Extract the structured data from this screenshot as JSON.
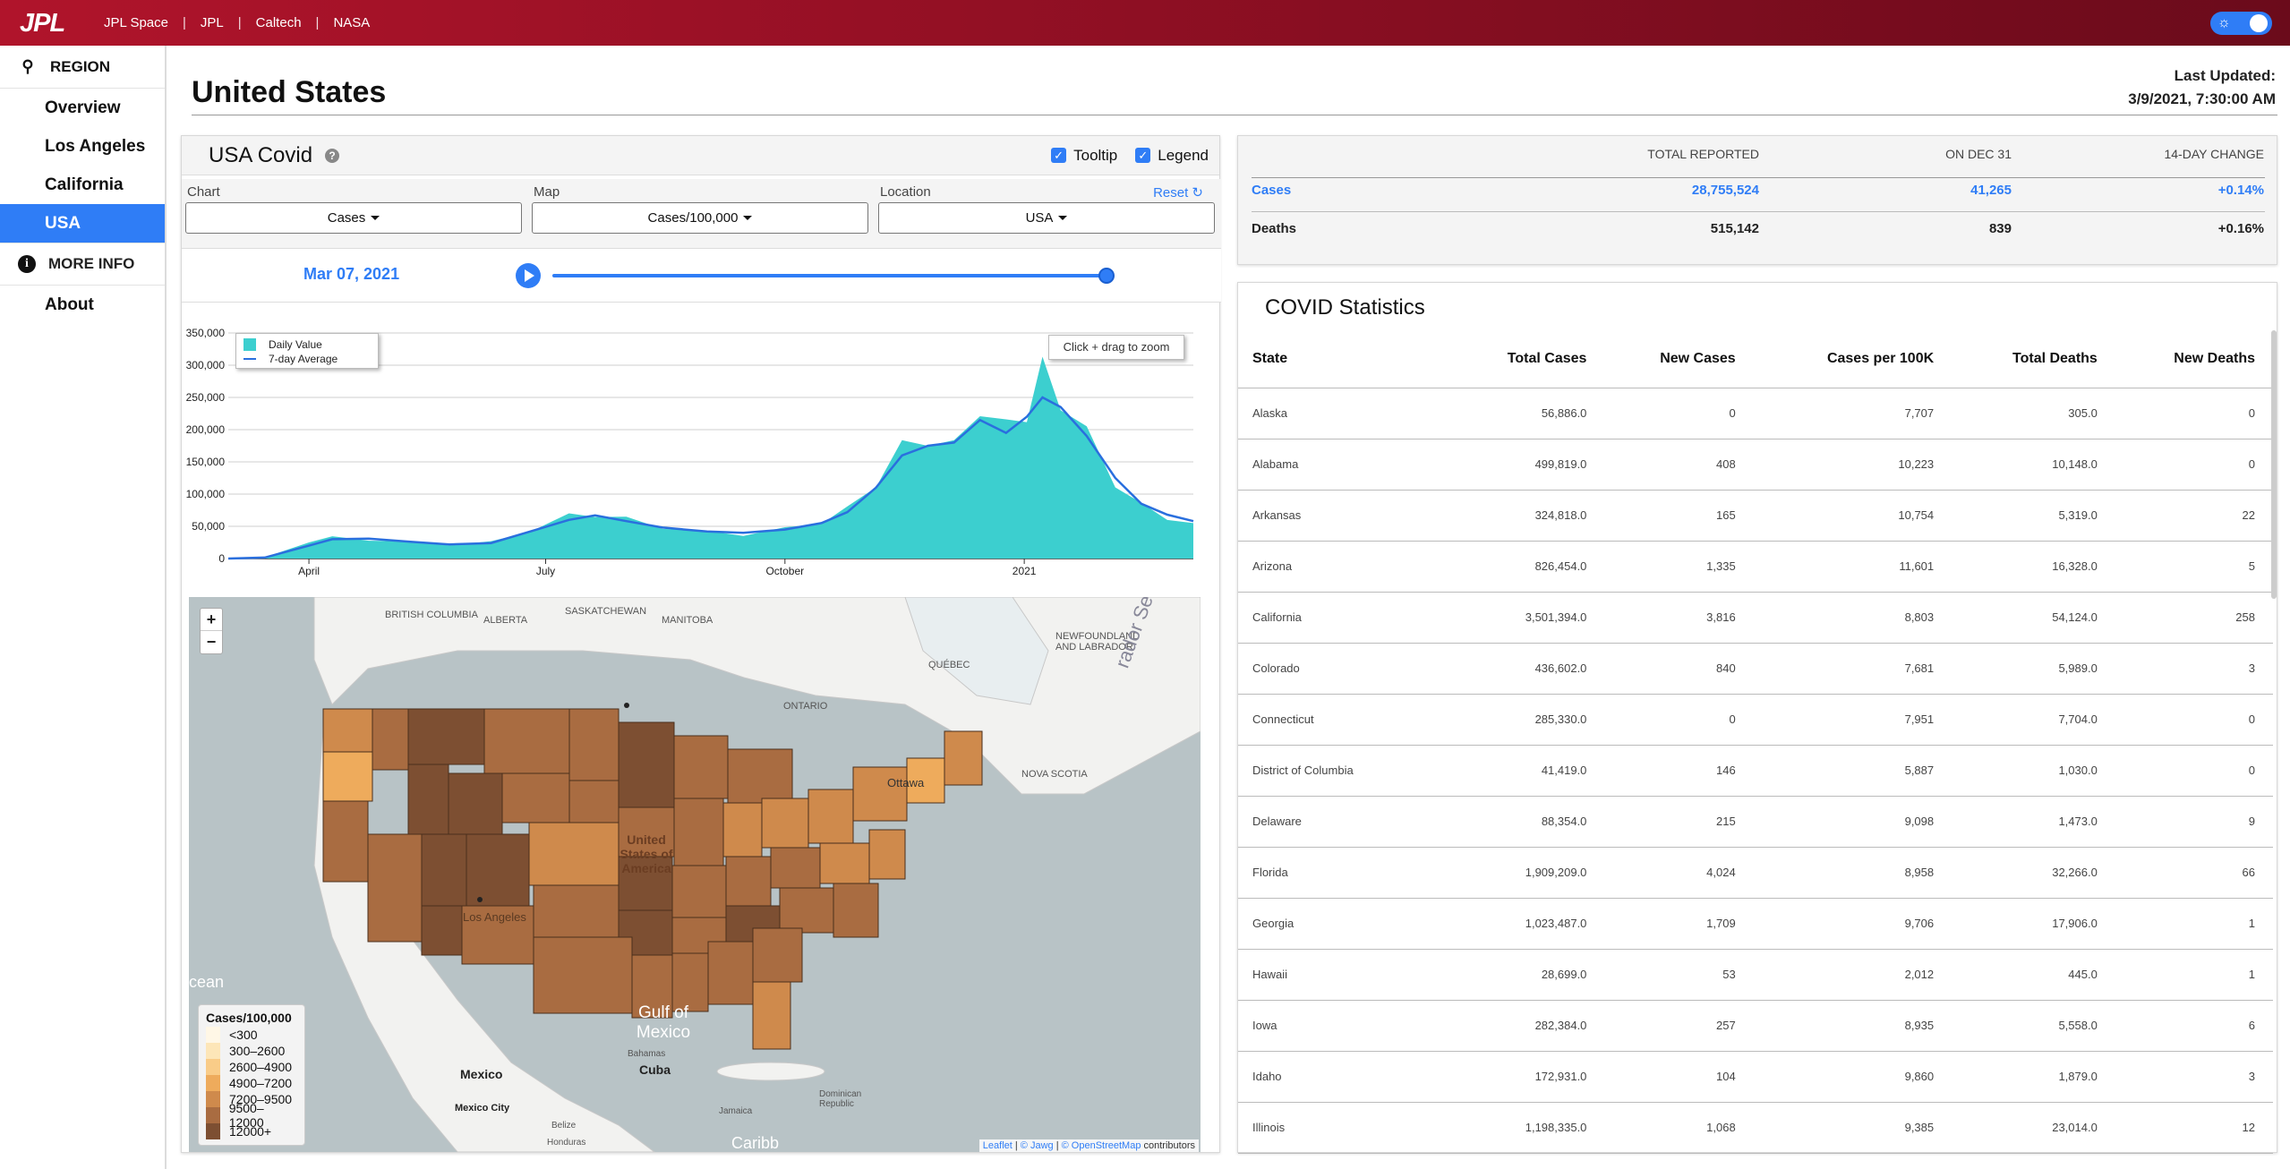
{
  "topbar": {
    "logo": "JPL",
    "links": [
      "JPL Space",
      "JPL",
      "Caltech",
      "NASA"
    ],
    "separator": "|"
  },
  "sidebar": {
    "region_label": "REGION",
    "items": [
      {
        "label": "Overview",
        "active": false
      },
      {
        "label": "Los Angeles",
        "active": false
      },
      {
        "label": "California",
        "active": false
      },
      {
        "label": "USA",
        "active": true
      }
    ],
    "more_info_label": "MORE INFO",
    "about_label": "About"
  },
  "header": {
    "title": "United States",
    "last_updated_label": "Last Updated:",
    "last_updated_value": "3/9/2021, 7:30:00 AM"
  },
  "covid_panel": {
    "title": "USA Covid",
    "tooltip_label": "Tooltip",
    "legend_label": "Legend",
    "chart_label": "Chart",
    "chart_value": "Cases",
    "map_label": "Map",
    "map_value": "Cases/100,000",
    "location_label": "Location",
    "location_value": "USA",
    "reset_label": "Reset",
    "current_date": "Mar 07, 2021",
    "slider_fraction": 1.0,
    "zoom_hint": "Click + drag to zoom",
    "legend_daily": "Daily Value",
    "legend_avg": "7-day Average"
  },
  "chart_data": {
    "type": "area",
    "title": "",
    "xlabel": "",
    "ylabel": "",
    "ylim": [
      0,
      350000
    ],
    "y_ticks": [
      "0",
      "50,000",
      "100,000",
      "150,000",
      "200,000",
      "250,000",
      "300,000",
      "350,000"
    ],
    "x_ticks": [
      "April",
      "July",
      "October",
      "2021"
    ],
    "series": [
      {
        "name": "Daily Value",
        "color": "#3ccfcf"
      },
      {
        "name": "7-day Average",
        "color": "#2a6fde"
      }
    ],
    "x": [
      "2020-03-01",
      "2020-03-15",
      "2020-04-01",
      "2020-04-10",
      "2020-04-24",
      "2020-05-10",
      "2020-05-25",
      "2020-06-10",
      "2020-06-25",
      "2020-07-10",
      "2020-07-20",
      "2020-08-01",
      "2020-08-15",
      "2020-09-01",
      "2020-09-15",
      "2020-10-01",
      "2020-10-15",
      "2020-10-25",
      "2020-11-05",
      "2020-11-15",
      "2020-11-25",
      "2020-12-05",
      "2020-12-15",
      "2020-12-25",
      "2021-01-02",
      "2021-01-08",
      "2021-01-15",
      "2021-01-25",
      "2021-02-05",
      "2021-02-15",
      "2021-02-25",
      "2021-03-07"
    ],
    "daily": [
      0,
      2000,
      25000,
      32000,
      30000,
      25000,
      22000,
      25000,
      45000,
      65000,
      70000,
      60000,
      50000,
      40000,
      38000,
      45000,
      58000,
      75000,
      120000,
      170000,
      190000,
      170000,
      240000,
      200000,
      230000,
      290000,
      250000,
      190000,
      120000,
      80000,
      65000,
      55000
    ],
    "avg": [
      0,
      1500,
      20000,
      30000,
      31000,
      26000,
      22000,
      24000,
      42000,
      60000,
      67000,
      58000,
      48000,
      42000,
      40000,
      45000,
      55000,
      72000,
      110000,
      160000,
      175000,
      180000,
      215000,
      195000,
      220000,
      250000,
      235000,
      190000,
      125000,
      85000,
      68000,
      58000
    ]
  },
  "map": {
    "legend_title": "Cases/100,000",
    "bins": [
      {
        "label": "<300",
        "color": "#fff7e6"
      },
      {
        "label": "300–2600",
        "color": "#fde6b8"
      },
      {
        "label": "2600–4900",
        "color": "#f9cc88"
      },
      {
        "label": "4900–7200",
        "color": "#eeab5c"
      },
      {
        "label": "7200–9500",
        "color": "#cf8a4c"
      },
      {
        "label": "9500–12000",
        "color": "#a96c41"
      },
      {
        "label": "12000+",
        "color": "#7d4f32"
      }
    ],
    "zoom_in": "+",
    "zoom_out": "−",
    "labels": {
      "usa": "United States of America",
      "mexico": "Mexico",
      "mexico_city": "Mexico City",
      "gulf": "Gulf of Mexico",
      "cuba": "Cuba",
      "ocean": "cean",
      "bc": "BRITISH COLUMBIA",
      "alberta": "ALBERTA",
      "sask": "SASKATCHEWAN",
      "manitoba": "MANITOBA",
      "ontario": "ONTARIO",
      "quebec": "QUÉBEC",
      "nfl": "NEWFOUNDLAND AND LABRADOR",
      "ottawa": "Ottawa",
      "losangeles": "Los Angeles",
      "bahamas": "Bahamas",
      "jamaica": "Jamaica",
      "dominican": "Dominican Republic",
      "belize": "Belize",
      "honduras": "Honduras",
      "caribbean": "Caribb",
      "labrador_sea": "rador Sea",
      "nova_scotia": "NOVA SCOTIA"
    },
    "attribution": {
      "leaflet": "Leaflet",
      "sep1": "|",
      "copy1": "© Jawg",
      "sep2": "|",
      "copy2": "© OpenStreetMap",
      "tail": "contributors"
    }
  },
  "summary": {
    "headers": [
      "TOTAL REPORTED",
      "ON DEC 31",
      "14-DAY CHANGE"
    ],
    "rows": [
      {
        "label": "Cases",
        "total": "28,755,524",
        "dec31": "41,265",
        "change": "+0.14%",
        "color": "#2f7df6"
      },
      {
        "label": "Deaths",
        "total": "515,142",
        "dec31": "839",
        "change": "+0.16%",
        "color": "#111111"
      }
    ]
  },
  "stats": {
    "title": "COVID Statistics",
    "columns": [
      "State",
      "Total Cases",
      "New Cases",
      "Cases per 100K",
      "Total Deaths",
      "New Deaths"
    ],
    "rows": [
      [
        "Alaska",
        "56,886.0",
        "0",
        "7,707",
        "305.0",
        "0"
      ],
      [
        "Alabama",
        "499,819.0",
        "408",
        "10,223",
        "10,148.0",
        "0"
      ],
      [
        "Arkansas",
        "324,818.0",
        "165",
        "10,754",
        "5,319.0",
        "22"
      ],
      [
        "Arizona",
        "826,454.0",
        "1,335",
        "11,601",
        "16,328.0",
        "5"
      ],
      [
        "California",
        "3,501,394.0",
        "3,816",
        "8,803",
        "54,124.0",
        "258"
      ],
      [
        "Colorado",
        "436,602.0",
        "840",
        "7,681",
        "5,989.0",
        "3"
      ],
      [
        "Connecticut",
        "285,330.0",
        "0",
        "7,951",
        "7,704.0",
        "0"
      ],
      [
        "District of Columbia",
        "41,419.0",
        "146",
        "5,887",
        "1,030.0",
        "0"
      ],
      [
        "Delaware",
        "88,354.0",
        "215",
        "9,098",
        "1,473.0",
        "9"
      ],
      [
        "Florida",
        "1,909,209.0",
        "4,024",
        "8,958",
        "32,266.0",
        "66"
      ],
      [
        "Georgia",
        "1,023,487.0",
        "1,709",
        "9,706",
        "17,906.0",
        "1"
      ],
      [
        "Hawaii",
        "28,699.0",
        "53",
        "2,012",
        "445.0",
        "1"
      ],
      [
        "Iowa",
        "282,384.0",
        "257",
        "8,935",
        "5,558.0",
        "6"
      ],
      [
        "Idaho",
        "172,931.0",
        "104",
        "9,860",
        "1,879.0",
        "3"
      ],
      [
        "Illinois",
        "1,198,335.0",
        "1,068",
        "9,385",
        "23,014.0",
        "12"
      ]
    ]
  }
}
